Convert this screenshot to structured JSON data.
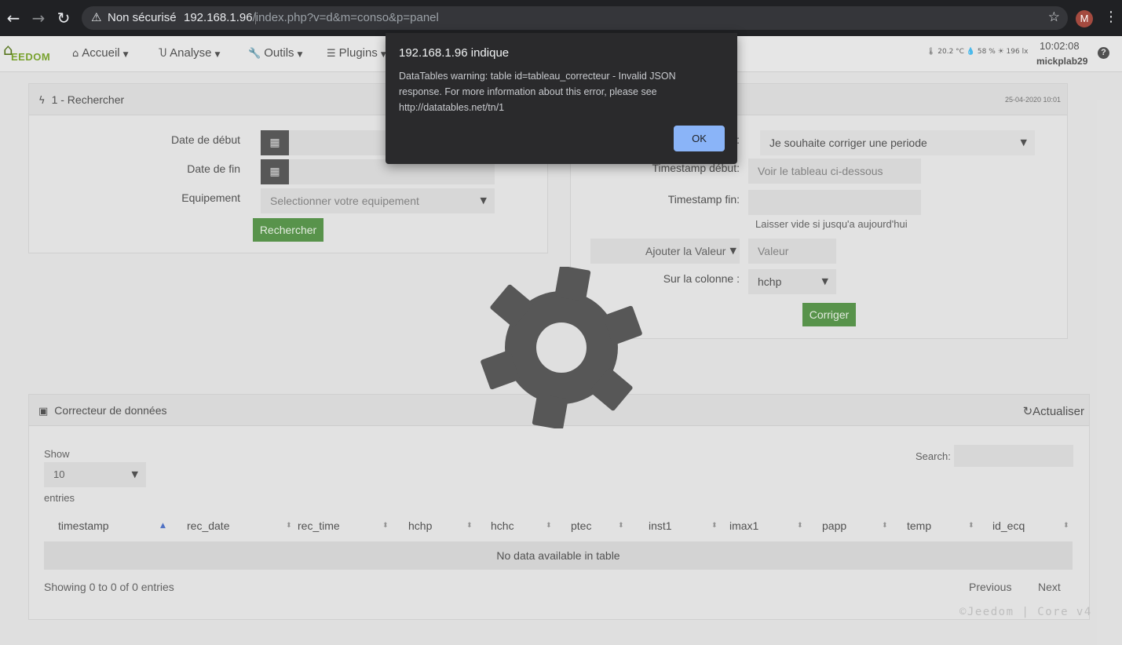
{
  "browser": {
    "security_label": "Non sécurisé",
    "url_host": "192.168.1.96",
    "url_path": "/index.php?v=d&m=conso&p=panel",
    "profile_initial": "M"
  },
  "nav": {
    "logo_text": "EEDOM",
    "menus": [
      {
        "label": "Accueil"
      },
      {
        "label": "Analyse"
      },
      {
        "label": "Outils"
      },
      {
        "label": "Plugins"
      }
    ],
    "sensors": "🌡 20.2 °C  💧 58 %  ☀ 196 lx",
    "time": "10:02:08",
    "user": "mickplab29",
    "help": "?"
  },
  "search_panel": {
    "title": "1 - Rechercher",
    "date_debut_label": "Date de début",
    "date_fin_label": "Date de fin",
    "equipement_label": "Equipement",
    "equipement_placeholder": "Selectionner votre equipement",
    "search_button": "Rechercher"
  },
  "correct_panel": {
    "date": "25-04-2020 10:01",
    "mode_value": "Je souhaite corriger une periode",
    "ts_debut_label": "Timestamp début:",
    "ts_debut_placeholder": "Voir le tableau ci-dessous",
    "ts_fin_label": "Timestamp fin:",
    "ts_fin_hint": "Laisser vide si jusqu'a aujourd'hui",
    "action_value": "Ajouter la Valeur",
    "valeur_placeholder": "Valeur",
    "column_label": "Sur la colonne :",
    "column_value": "hchp",
    "correct_button": "Corriger"
  },
  "data_panel": {
    "title": "Correcteur de données",
    "refresh": "Actualiser",
    "show_label": "Show",
    "length_value": "10",
    "entries_label": "entries",
    "search_label": "Search:",
    "columns": [
      "timestamp",
      "rec_date",
      "rec_time",
      "hchp",
      "hchc",
      "ptec",
      "inst1",
      "imax1",
      "papp",
      "temp",
      "id_ecq"
    ],
    "empty": "No data available in table",
    "info": "Showing 0 to 0 of 0 entries",
    "prev": "Previous",
    "next": "Next"
  },
  "footer": "©Jeedom | Core v4",
  "alert": {
    "title": "192.168.1.96 indique",
    "message": "DataTables warning: table id=tableau_correcteur - Invalid JSON response. For more information about this error, please see http://datatables.net/tn/1",
    "ok": "OK"
  }
}
